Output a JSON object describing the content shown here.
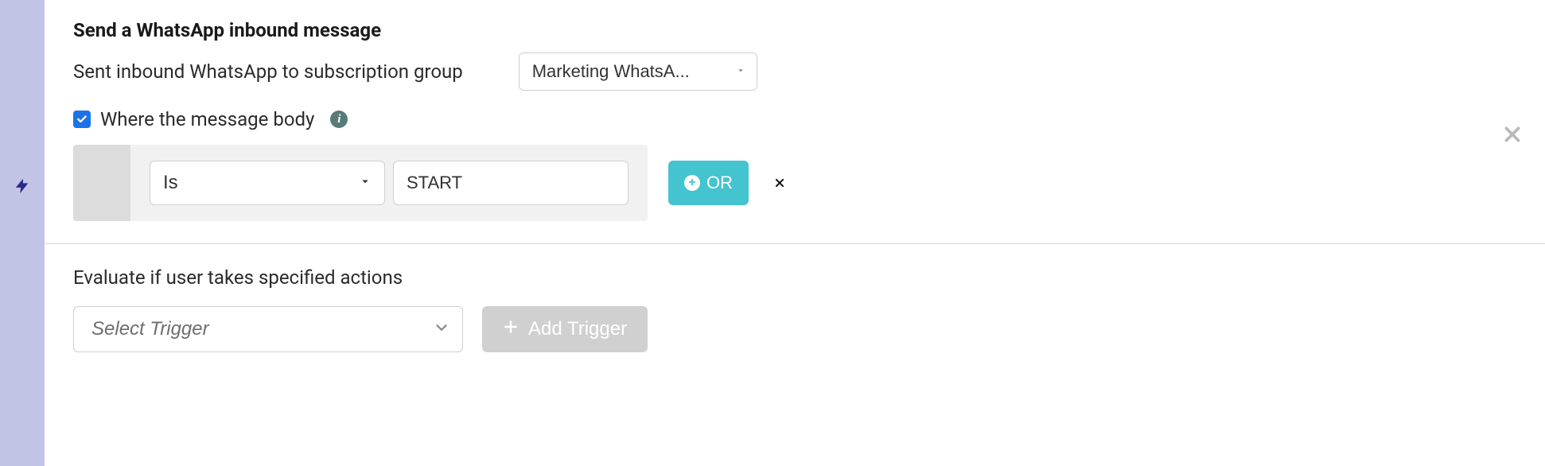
{
  "header": {
    "title": "Send a WhatsApp inbound message"
  },
  "subscription": {
    "label": "Sent inbound WhatsApp to subscription group",
    "selected": "Marketing WhatsA..."
  },
  "filter": {
    "checkbox_checked": true,
    "label": "Where the message body"
  },
  "condition": {
    "operator": "Is",
    "value": "START",
    "or_label": "OR"
  },
  "evaluate": {
    "label": "Evaluate if user takes specified actions",
    "select_placeholder": "Select Trigger",
    "add_button": "Add Trigger"
  }
}
